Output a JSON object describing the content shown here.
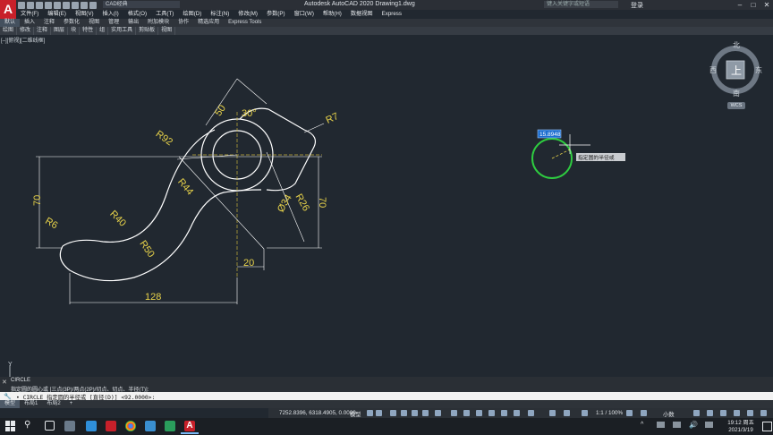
{
  "titlebar": {
    "app_logo": "A",
    "workspace": "CAD经典",
    "title": "Autodesk AutoCAD 2020    Drawing1.dwg",
    "search_placeholder": "键入关键字或短语",
    "login": "登录",
    "minimize": "–",
    "maximize": "□",
    "close": "✕"
  },
  "menubar": [
    "文件(F)",
    "编辑(E)",
    "视图(V)",
    "插入(I)",
    "格式(O)",
    "工具(T)",
    "绘图(D)",
    "标注(N)",
    "修改(M)",
    "参数(P)",
    "窗口(W)",
    "帮助(H)",
    "数据视图",
    "Express"
  ],
  "ribbon_tabs": [
    "默认",
    "插入",
    "注释",
    "参数化",
    "视图",
    "管理",
    "输出",
    "附加模块",
    "协作",
    "精选应用",
    "Express Tools"
  ],
  "panel_tabs": [
    "绘图",
    "修改",
    "注释",
    "图层",
    "块",
    "特性",
    "组",
    "实用工具",
    "剪贴板",
    "视图"
  ],
  "viewport_label": "[–][俯视][二维线框]",
  "viewcube": {
    "north": "北",
    "south": "南",
    "east": "东",
    "west": "西",
    "face": "上",
    "wcs": "WCS"
  },
  "drawing": {
    "dims": {
      "d50": "50",
      "d30": "30°",
      "r7": "R7",
      "r92": "R92",
      "r44": "R44",
      "r26": "R26",
      "d34": "Ø34",
      "d70left": "70",
      "d70right": "70",
      "r40": "R40",
      "r6": "R6",
      "r50": "R50",
      "d20": "20",
      "d128": "128"
    },
    "radius_input": "15.8948",
    "tooltip": "指定圆的半径或",
    "ucs_y": "Y"
  },
  "command": {
    "hist1": "CIRCLE",
    "hist2": "指定圆的圆心或 [三点(3P)/两点(2P)/切点、切点、半径(T)]:",
    "line": "• CIRCLE 指定圆的半径或 [直径(D)] <92.0000>:"
  },
  "layout_tabs": [
    "模型",
    "布局1",
    "布局2",
    "+"
  ],
  "status": {
    "coords": "7252.8396, 6318.4905, 0.0000",
    "model": "模型",
    "scale": "1:1 / 100%",
    "units": "小数"
  },
  "clock": {
    "time": "19:12 周五",
    "date": "2021/3/19"
  },
  "colors": {
    "drawing_line": "#ffffff",
    "dimension": "#e8d34a",
    "circle_preview": "#2ecc40",
    "background": "#212830"
  }
}
